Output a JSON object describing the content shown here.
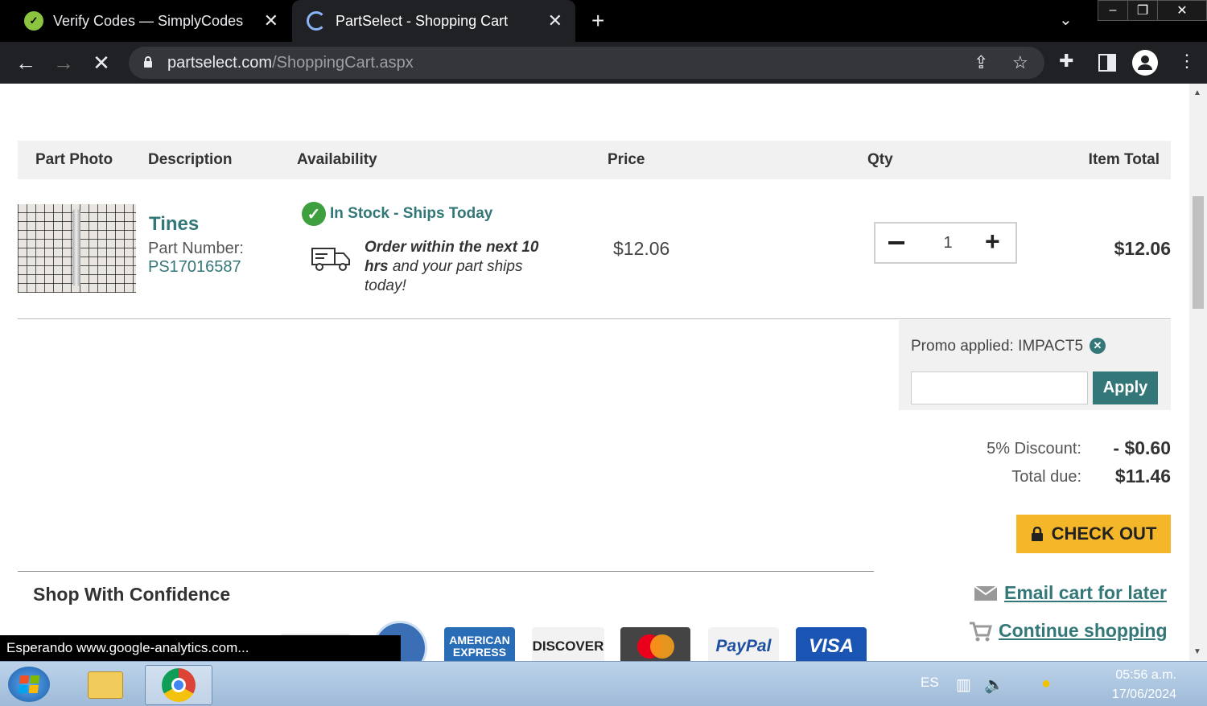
{
  "browser": {
    "tabs": [
      {
        "title": "Verify Codes — SimplyCodes",
        "favicon": "simplycodes-icon",
        "active": false
      },
      {
        "title": "PartSelect - Shopping Cart",
        "favicon": "loading-spinner-icon",
        "active": true
      }
    ],
    "new_tab_label": "+",
    "url_host": "partselect.com",
    "url_path": "/ShoppingCart.aspx",
    "status_text": "Esperando www.google-analytics.com..."
  },
  "cart": {
    "columns": [
      "Part Photo",
      "Description",
      "Availability",
      "Price",
      "Qty",
      "Item Total"
    ],
    "item": {
      "name": "Tines",
      "part_number_label": "Part Number:",
      "part_number": "PS17016587",
      "availability": "In Stock - Ships Today",
      "ship_msg_bold": "Order within the next 10 hrs",
      "ship_msg_rest": " and your part ships today!",
      "price": "$12.06",
      "qty": "1",
      "item_total": "$12.06"
    },
    "promo": {
      "applied_text": "Promo applied: IMPACT5",
      "input_value": "",
      "apply_label": "Apply"
    },
    "summary": {
      "discount_label": "5% Discount:",
      "discount_value": "- $0.60",
      "total_label": "Total due:",
      "total_value": "$11.46"
    },
    "checkout_label": "CHECK OUT",
    "email_cart_label": "Email cart for later",
    "continue_label": "Continue shopping",
    "confidence_title": "Shop With Confidence",
    "payment_cards": [
      "AMERICAN EXPRESS",
      "DISCOVER",
      "PayPal",
      "VISA"
    ]
  },
  "taskbar": {
    "language": "ES",
    "time": "05:56 a.m.",
    "date": "17/06/2024"
  },
  "colors": {
    "accent_teal": "#337778",
    "checkout_yellow": "#f5b72a",
    "in_stock_green": "#3e9f3e"
  }
}
